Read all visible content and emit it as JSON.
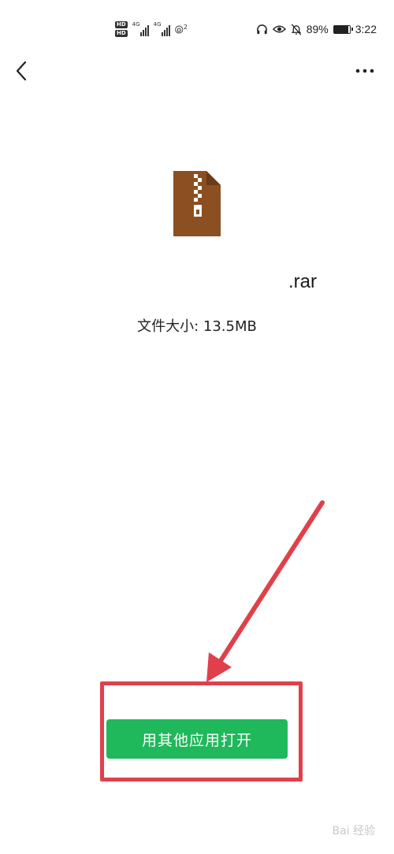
{
  "status_bar": {
    "hd_badge_1": "HD",
    "hd_badge_2": "HD",
    "network_1": "4G",
    "network_2": "4G",
    "hotspot_count": "2",
    "battery_text": "89%",
    "battery_level": 0.89,
    "time": "3:22"
  },
  "file": {
    "name_visible": ".rar",
    "size_label": "文件大小: ",
    "size_value": "13.5MB",
    "icon": "zip-archive-icon",
    "icon_color": "#8b4f22"
  },
  "actions": {
    "open_with_other_app": "用其他应用打开",
    "button_color": "#1fb85b",
    "highlight_color": "#e0404a"
  },
  "watermark": "Bai 经验"
}
